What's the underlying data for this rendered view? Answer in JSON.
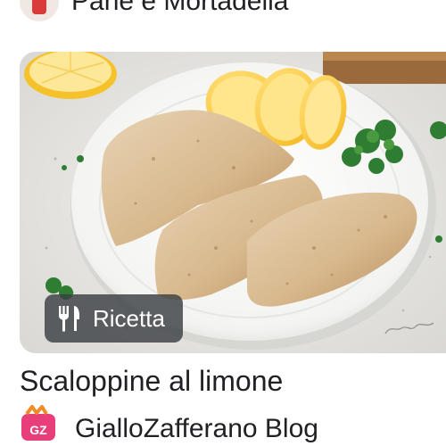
{
  "top_result": {
    "source_name": "Pane e Mortadella"
  },
  "main_result": {
    "badge_label": "Ricetta",
    "title": "Scaloppine al limone",
    "source_name": "GialloZafferano Blog",
    "source_logo_text": "GZ"
  },
  "icons": {
    "badge": "fork-knife-icon",
    "source": "giallozafferano-logo"
  },
  "colors": {
    "badge_bg": "#3c4043",
    "logo_pink": "#e83e7a",
    "logo_orange": "#f08a24"
  }
}
